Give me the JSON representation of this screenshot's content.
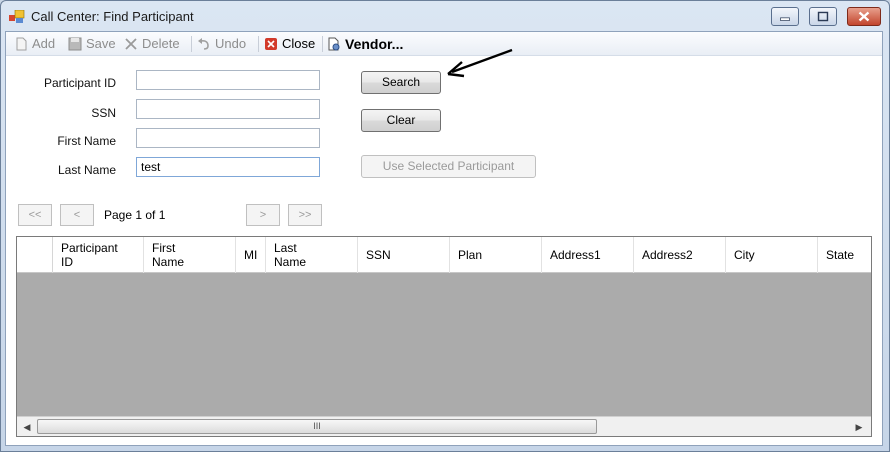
{
  "window": {
    "title": "Call Center: Find Participant",
    "minimize_icon": "minimize-icon",
    "maximize_icon": "maximize-icon",
    "close_icon": "close-icon"
  },
  "toolbar": {
    "add": {
      "label": "Add",
      "icon": "add-document-icon",
      "enabled": false
    },
    "save": {
      "label": "Save",
      "icon": "save-disk-icon",
      "enabled": false
    },
    "delete": {
      "label": "Delete",
      "icon": "delete-x-icon",
      "enabled": false
    },
    "undo": {
      "label": "Undo",
      "icon": "undo-arrow-icon",
      "enabled": false
    },
    "close": {
      "label": "Close",
      "icon": "close-red-icon",
      "enabled": true
    },
    "vendor": {
      "label": "Vendor...",
      "icon": "vendor-document-icon",
      "enabled": true
    }
  },
  "form": {
    "participant_id": {
      "label": "Participant ID",
      "value": ""
    },
    "ssn": {
      "label": "SSN",
      "value": ""
    },
    "first_name": {
      "label": "First Name",
      "value": ""
    },
    "last_name": {
      "label": "Last Name",
      "value": "test"
    }
  },
  "buttons": {
    "search": "Search",
    "clear": "Clear",
    "use_selected": "Use Selected Participant"
  },
  "pager": {
    "first": "<<",
    "prev": "<",
    "status": "Page 1 of 1",
    "next": ">",
    "last": ">>"
  },
  "grid": {
    "columns": [
      {
        "line1": "Participant",
        "line2": "ID"
      },
      {
        "line1": "First",
        "line2": "Name"
      },
      {
        "line1": "MI",
        "line2": ""
      },
      {
        "line1": "Last",
        "line2": "Name"
      },
      {
        "line1": "SSN",
        "line2": ""
      },
      {
        "line1": "Plan",
        "line2": ""
      },
      {
        "line1": "Address1",
        "line2": ""
      },
      {
        "line1": "Address2",
        "line2": ""
      },
      {
        "line1": "City",
        "line2": ""
      },
      {
        "line1": "State",
        "line2": ""
      }
    ],
    "rows": [],
    "scroll_thumb_grip": "III"
  },
  "colors": {
    "window_frame": "#c6d5e8",
    "grid_background": "#ababab",
    "close_button": "#c2452d"
  },
  "annotation": {
    "icon": "pointer-arrow-icon"
  }
}
